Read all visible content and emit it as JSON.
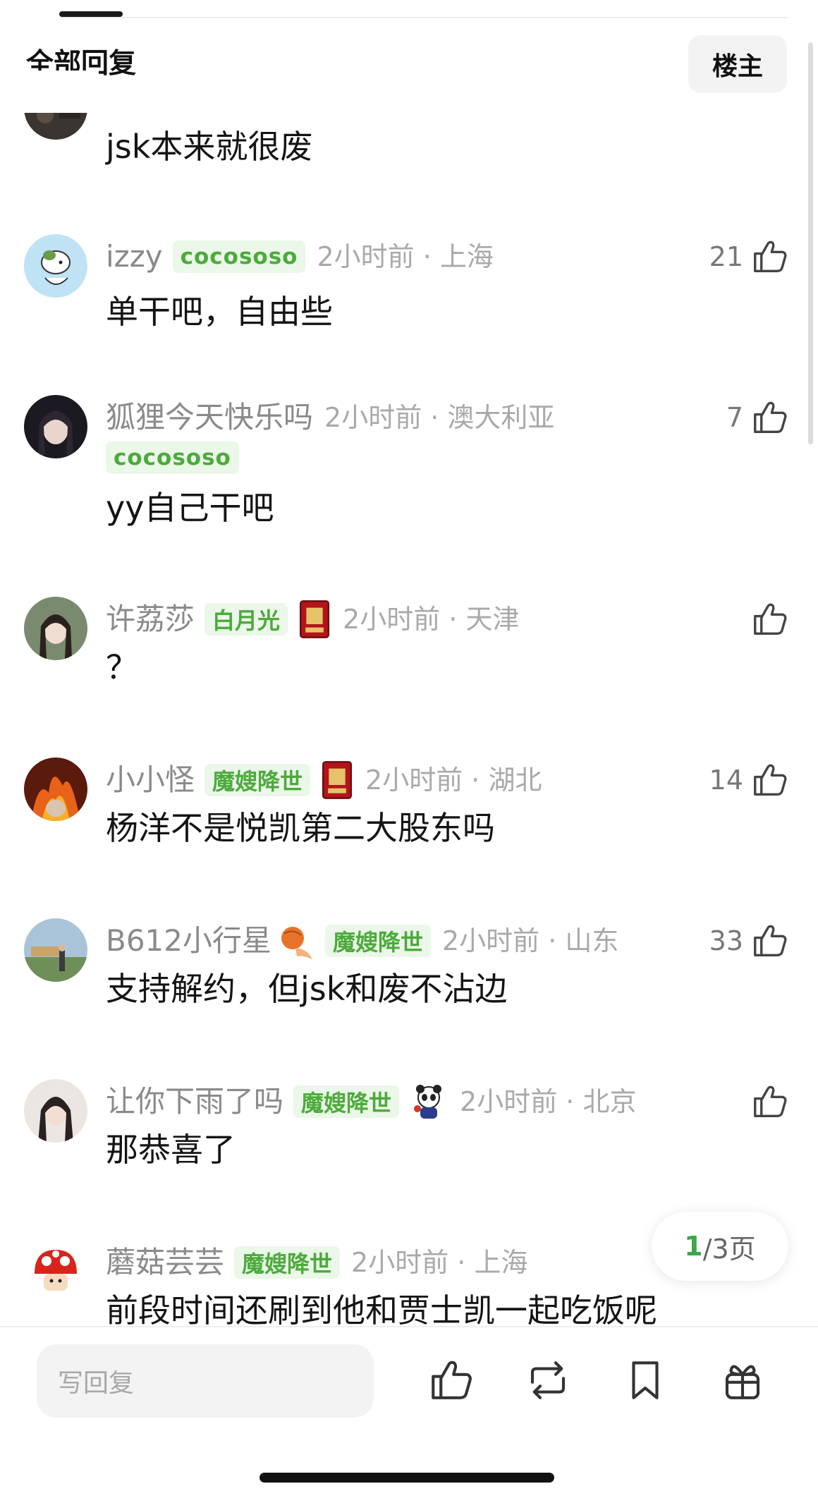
{
  "header": {
    "section_title": "全部回复",
    "filter_label": "楼主"
  },
  "comments": [
    {
      "text": "jsk本来就很废"
    },
    {
      "username": "izzy",
      "tag": "cocososo",
      "time_location": "2小时前 · 上海",
      "text": "单干吧，自由些",
      "likes": "21"
    },
    {
      "username": "狐狸今天快乐吗",
      "tag": "cocososo",
      "time_location": "2小时前 · 澳大利亚",
      "text": "yy自己干吧",
      "likes": "7"
    },
    {
      "username": "许荔莎",
      "tag": "白月光",
      "time_location": "2小时前 · 天津",
      "text": "？",
      "likes": ""
    },
    {
      "username": "小小怪",
      "tag": "魔嫂降世",
      "time_location": "2小时前 · 湖北",
      "text": "杨洋不是悦凯第二大股东吗",
      "likes": "14"
    },
    {
      "username": "B612小行星",
      "tag": "魔嫂降世",
      "time_location": "2小时前 · 山东",
      "text": "支持解约，但jsk和废不沾边",
      "likes": "33"
    },
    {
      "username": "让你下雨了吗",
      "tag": "魔嫂降世",
      "time_location": "2小时前 · 北京",
      "text": "那恭喜了",
      "likes": ""
    },
    {
      "username": "蘑菇芸芸",
      "tag": "魔嫂降世",
      "time_location": "2小时前 · 上海",
      "text": "前段时间还刷到他和贾士凯一起吃饭呢"
    }
  ],
  "pagination": {
    "current": "1",
    "total_label": "/3页"
  },
  "bottom_bar": {
    "reply_placeholder": "写回复"
  },
  "colors": {
    "accent_green": "#4caa3c",
    "tag_bg": "#ebf7e8",
    "meta_gray": "#8a8a8a"
  }
}
